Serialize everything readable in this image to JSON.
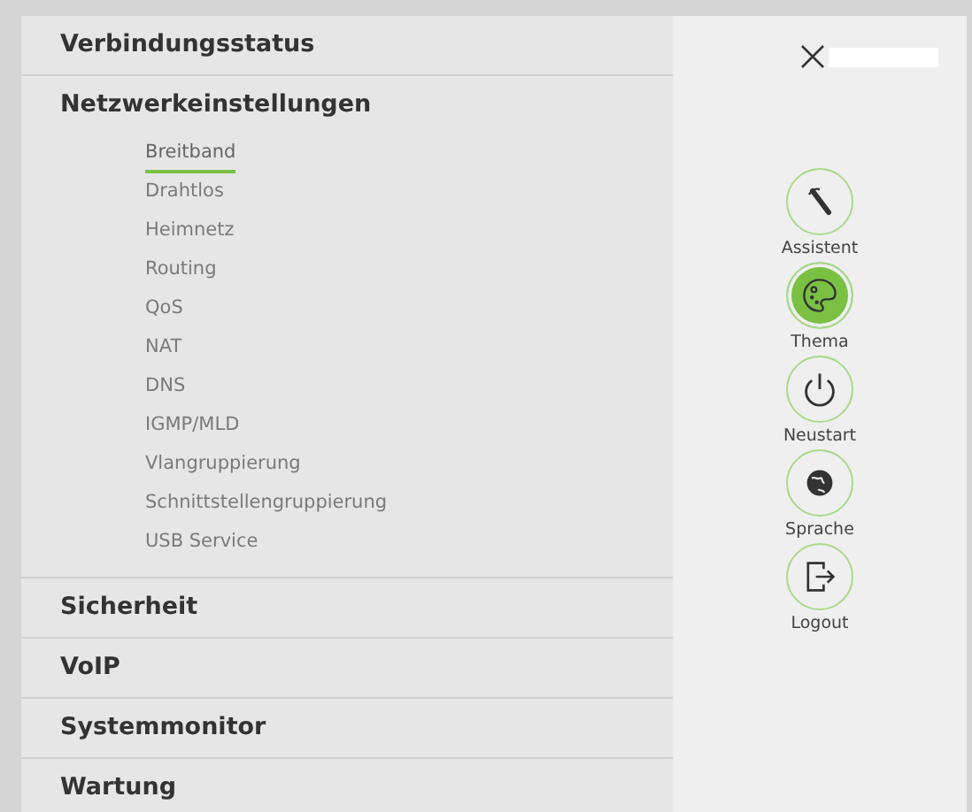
{
  "menu": [
    {
      "label": "Verbindungsstatus"
    },
    {
      "label": "Netzwerkeinstellungen",
      "children": [
        {
          "label": "Breitband",
          "selected": true
        },
        {
          "label": "Drahtlos",
          "selected": false
        },
        {
          "label": "Heimnetz",
          "selected": false
        },
        {
          "label": "Routing",
          "selected": false
        },
        {
          "label": "QoS",
          "selected": false
        },
        {
          "label": "NAT",
          "selected": false
        },
        {
          "label": "DNS",
          "selected": false
        },
        {
          "label": "IGMP/MLD",
          "selected": false
        },
        {
          "label": "Vlangruppierung",
          "selected": false
        },
        {
          "label": "Schnittstellengruppierung",
          "selected": false
        },
        {
          "label": "USB Service",
          "selected": false
        }
      ]
    },
    {
      "label": "Sicherheit"
    },
    {
      "label": "VoIP"
    },
    {
      "label": "Systemmonitor"
    },
    {
      "label": "Wartung"
    }
  ],
  "side_actions": [
    {
      "kind": "wizard",
      "label": "Assistent",
      "selected": false
    },
    {
      "kind": "theme",
      "label": "Thema",
      "selected": true
    },
    {
      "kind": "restart",
      "label": "Neustart",
      "selected": false
    },
    {
      "kind": "language",
      "label": "Sprache",
      "selected": false
    },
    {
      "kind": "logout",
      "label": "Logout",
      "selected": false
    }
  ]
}
